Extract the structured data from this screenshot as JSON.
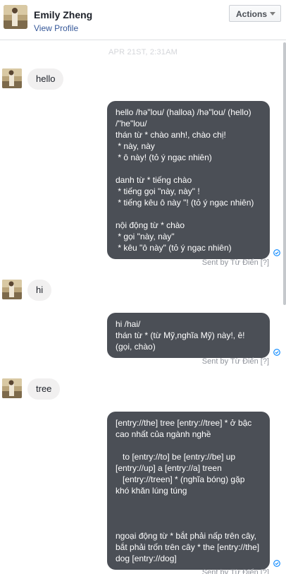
{
  "header": {
    "name": "Emily Zheng",
    "profile_link": "View Profile",
    "actions_label": "Actions"
  },
  "timestamp": "APR 21ST, 2:31AM",
  "colors": {
    "outgoing_bubble": "#4b4f56",
    "incoming_bubble": "#f1f0f0",
    "link": "#365899",
    "seen_icon": "#0084ff"
  },
  "icons": {
    "actions_caret": "chevron-down-icon",
    "seen": "check-circle-icon"
  },
  "messages": [
    {
      "direction": "in",
      "text": "hello"
    },
    {
      "direction": "out",
      "lines": [
        "hello /hə\"lou/ (halloa) /hə\"lou/ (hello)",
        "/\"he\"lou/",
        "thán từ * chào anh!, chào chị!",
        " * này, này",
        " * ô này! (tỏ ý ngạc nhiên)",
        "",
        "danh từ * tiếng chào",
        " * tiếng gọi \"này, này\" !",
        " * tiếng kêu ô này \"! (tỏ ý ngạc nhiên)",
        "",
        "nội động từ * chào",
        " * gọi \"này, này\"",
        " * kêu \"ô này\" (tỏ ý ngạc nhiên)"
      ],
      "sent_by_prefix": "Sent by",
      "sent_by_source": "Từ Điển",
      "help": "[?]"
    },
    {
      "direction": "in",
      "text": "hi"
    },
    {
      "direction": "out",
      "lines": [
        "hi /hai/",
        "thán từ * (từ Mỹ,nghĩa Mỹ) này!, ê!",
        "(gọi, chào)"
      ],
      "sent_by_prefix": "Sent by",
      "sent_by_source": "Từ Điển",
      "help": "[?]"
    },
    {
      "direction": "in",
      "text": "tree"
    },
    {
      "direction": "out",
      "lines": [
        "[entry://the] tree [entry://tree] * ở bậc",
        "cao nhất của ngành nghề",
        "",
        "   to [entry://to] be [entry://be] up",
        "[entry://up] a [entry://a] treen",
        "   [entry://treen] * (nghĩa bóng) gặp",
        "khó khăn lúng túng",
        "",
        "",
        "",
        "ngoại động từ * bắt phải nấp trên cây,",
        "bắt phải trốn trên cây * the [entry://the]",
        "dog [entry://dog]"
      ],
      "sent_by_prefix": "Sent by",
      "sent_by_source": "Từ Điển",
      "help": "[?]"
    }
  ]
}
